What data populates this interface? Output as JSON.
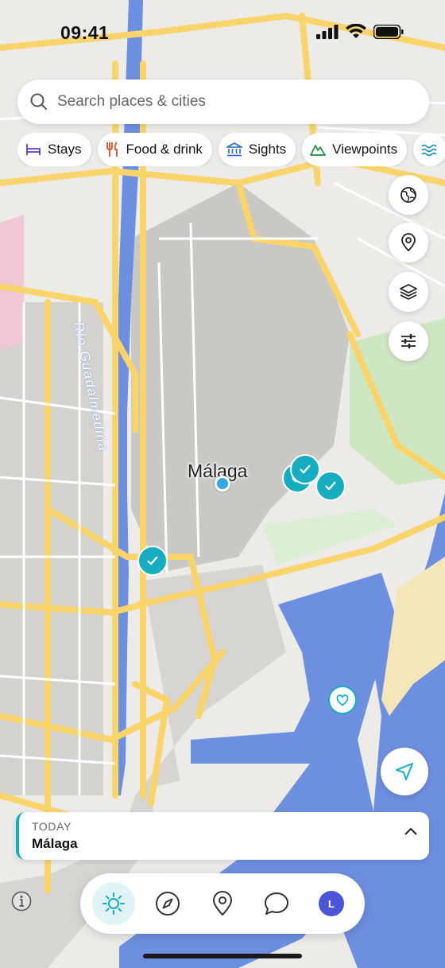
{
  "status_bar": {
    "time": "09:41"
  },
  "search": {
    "placeholder": "Search places & cities"
  },
  "categories": [
    {
      "label": "Stays",
      "icon": "bed-icon",
      "color": "#5b3fc4"
    },
    {
      "label": "Food & drink",
      "icon": "fork-knife-icon",
      "color": "#d0522a"
    },
    {
      "label": "Sights",
      "icon": "landmark-icon",
      "color": "#2268c4"
    },
    {
      "label": "Viewpoints",
      "icon": "mountain-icon",
      "color": "#1b8a3c"
    },
    {
      "label": "",
      "icon": "waves-icon",
      "color": "#1a8fb0"
    }
  ],
  "map_controls": [
    "globe-icon",
    "map-pin-icon",
    "layers-icon",
    "sliders-icon"
  ],
  "map": {
    "city_label": "Málaga",
    "river_label": "Río Guadalmedina"
  },
  "today": {
    "kicker": "TODAY",
    "place": "Málaga"
  },
  "tabs": [
    {
      "name": "tab-today",
      "icon": "sun-icon",
      "active": true
    },
    {
      "name": "tab-explore",
      "icon": "compass-icon",
      "active": false
    },
    {
      "name": "tab-places",
      "icon": "map-pin-icon",
      "active": false
    },
    {
      "name": "tab-chat",
      "icon": "chat-bubble-icon",
      "active": false
    },
    {
      "name": "tab-profile",
      "icon": "avatar",
      "active": false,
      "avatar_initial": "L"
    }
  ],
  "colors": {
    "accent": "#16adc1",
    "water": "#6d8fe0",
    "road": "#f8d46a",
    "land": "#ecebe8",
    "park": "#cfe6c3"
  }
}
